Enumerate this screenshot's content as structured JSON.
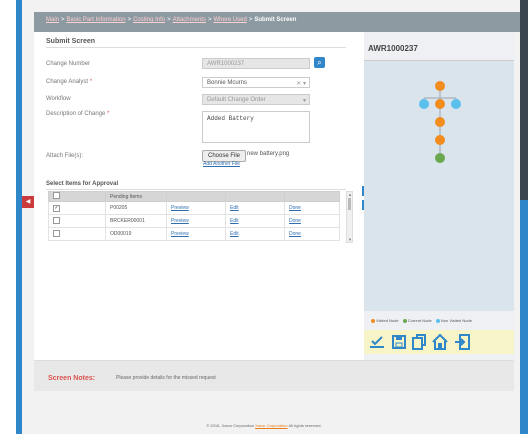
{
  "breadcrumb": {
    "items": [
      "Main",
      "Basic Part Information",
      "Costing Info",
      "Attachments",
      "Where Used"
    ],
    "current": "Submit Screen"
  },
  "form": {
    "section_title": "Submit Screen",
    "change_number": {
      "label": "Change Number",
      "value": "AWR1000237"
    },
    "change_analyst": {
      "label": "Change Analyst",
      "value": "Bonnie Mcurns"
    },
    "workflow": {
      "label": "Workflow",
      "value": "Default Change Order"
    },
    "description": {
      "label": "Description of Change",
      "value": "Added Battery"
    },
    "attach": {
      "label": "Attach File(s):",
      "button": "Choose File",
      "file_name": "new battery.png",
      "add_link": "Add Another File"
    }
  },
  "approval": {
    "title": "Select Items for Approval",
    "columns": [
      "Pending Items",
      "",
      "",
      ""
    ],
    "rows": [
      {
        "checked": true,
        "item": "P00205",
        "preview": "Preview",
        "edit": "Edit",
        "done": "Done"
      },
      {
        "checked": false,
        "item": "BRCKER00001",
        "preview": "Preview",
        "edit": "Edit",
        "done": "Done"
      },
      {
        "checked": false,
        "item": "OD00019",
        "preview": "Preview",
        "edit": "Edit",
        "done": "Done"
      }
    ]
  },
  "side": {
    "title": "AWR1000237",
    "legend": [
      {
        "label": "Visited Node",
        "color": "#f28c1e"
      },
      {
        "label": "Current Node",
        "color": "#6aa84f"
      },
      {
        "label": "Non Visited Node",
        "color": "#5bc0eb"
      }
    ],
    "toolbar_icons": [
      "approve-icon",
      "save-icon",
      "copy-icon",
      "home-icon",
      "exit-icon"
    ]
  },
  "notes": {
    "label": "Screen Notes:",
    "text": "Please provide details for the missed request"
  },
  "footer": {
    "prefix": "© 2016, Xavor Corporation",
    "link": "Xavor Corporation",
    "suffix": "All rights reserved."
  },
  "colors": {
    "accent": "#2f86c8",
    "required": "#d9534f",
    "visited": "#f28c1e",
    "current": "#6aa84f",
    "non_visited": "#5bc0eb"
  }
}
